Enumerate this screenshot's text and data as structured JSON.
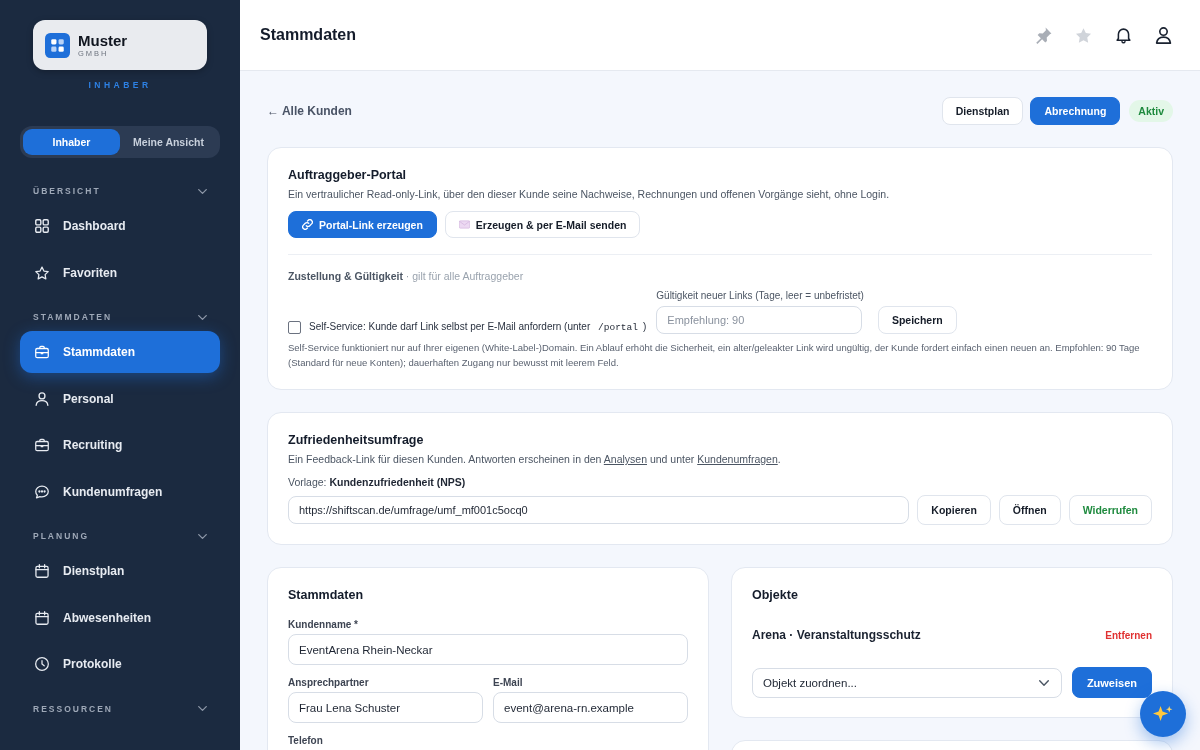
{
  "sidebar": {
    "brand": {
      "name": "Muster",
      "suffix": "GMBH"
    },
    "role": "INHABER",
    "view_toggle": [
      {
        "label": "Inhaber",
        "selected": true
      },
      {
        "label": "Meine Ansicht",
        "selected": false
      }
    ],
    "sections": [
      {
        "title": "ÜBERSICHT",
        "items": [
          {
            "label": "Dashboard",
            "selected": false
          },
          {
            "label": "Favoriten",
            "selected": false
          }
        ]
      },
      {
        "title": "STAMMDATEN",
        "items": [
          {
            "label": "Stammdaten",
            "selected": true
          },
          {
            "label": "Personal",
            "selected": false
          },
          {
            "label": "Recruiting",
            "selected": false
          },
          {
            "label": "Kundenumfragen",
            "selected": false
          }
        ]
      },
      {
        "title": "PLANUNG",
        "items": [
          {
            "label": "Dienstplan",
            "selected": false
          },
          {
            "label": "Abwesenheiten",
            "selected": false
          },
          {
            "label": "Protokolle",
            "selected": false
          }
        ]
      },
      {
        "title": "RESSOURCEN"
      }
    ]
  },
  "header": {
    "title": "Stammdaten"
  },
  "toolbar": {
    "back_link": "← Alle Kunden",
    "actions": [
      {
        "label": "Dienstplan",
        "kind": "secondary"
      },
      {
        "label": "Abrechnung",
        "kind": "primary"
      }
    ],
    "status": "Aktiv"
  },
  "portal": {
    "title": "Auftraggeber-Portal",
    "description": "Ein vertraulicher Read-only-Link, über den dieser Kunde seine Nachweise, Rechnungen und offenen Vorgänge sieht, ohne Login.",
    "buttons": [
      {
        "label": "Portal-Link erzeugen",
        "kind": "primary"
      },
      {
        "label": "Erzeugen & per E-Mail senden",
        "kind": "secondary"
      }
    ],
    "delivery": "**Zustellung & Gültigkeit** · gilt für alle Auftraggeber",
    "self_service": {
      "checked": false,
      "label": "Self-Service: Kunde darf Link selbst per E-Mail anfordern (unter",
      "path": "/portal",
      "label_end": ")"
    },
    "validity": {
      "label": "Gültigkeit neuer Links (Tage, leer = unbefristet)",
      "placeholder": "Empfehlung: 90"
    },
    "save_button": "Speichern",
    "help": "Self-Service funktioniert nur auf Ihrer eigenen (White-Label-)Domain. Ein Ablauf erhöht die Sicherheit, ein alter/geleakter Link wird ungültig, der Kunde fordert einfach einen neuen an. Empfohlen: 90 Tage (Standard für neue Konten); dauerhaften Zugang nur bewusst mit leerem Feld."
  },
  "survey": {
    "title": "Zufriedenheitsumfrage",
    "description": [
      {
        "kind": "text",
        "text": "Ein Feedback-Link für diesen Kunden. Antworten erscheinen in den "
      },
      {
        "kind": "link",
        "text": "Analysen"
      },
      {
        "kind": "text",
        "text": " und unter "
      },
      {
        "kind": "link",
        "text": "Kundenumfragen"
      },
      {
        "kind": "text",
        "text": "."
      }
    ],
    "template": "Vorlage: **Kundenzufriedenheit (NPS)**",
    "link": "https://shiftscan.de/umfrage/umf_mf001c5ocq0",
    "buttons": [
      {
        "label": "Kopieren",
        "kind": "secondary"
      },
      {
        "label": "Öffnen",
        "kind": "secondary"
      },
      {
        "label": "Widerrufen",
        "kind": "success"
      }
    ]
  },
  "master_data": {
    "title": "Stammdaten",
    "fields": [
      {
        "label": "Kundenname *",
        "value": "EventArena Rhein-Neckar",
        "kind": "wide"
      },
      {
        "label": "Ansprechpartner",
        "value": "Frau Lena Schuster",
        "kind": "half"
      },
      {
        "label": "E-Mail",
        "value": "event@arena-rn.example",
        "kind": "half"
      },
      {
        "label": "Telefon",
        "kind": "half"
      }
    ]
  },
  "objects": {
    "title": "Objekte",
    "items": [
      {
        "name": "Arena · Veranstaltungsschutz",
        "remove": "Entfernen"
      }
    ],
    "select": {
      "value": "Objekt zuordnen..."
    },
    "assign_button": "Zuweisen"
  }
}
